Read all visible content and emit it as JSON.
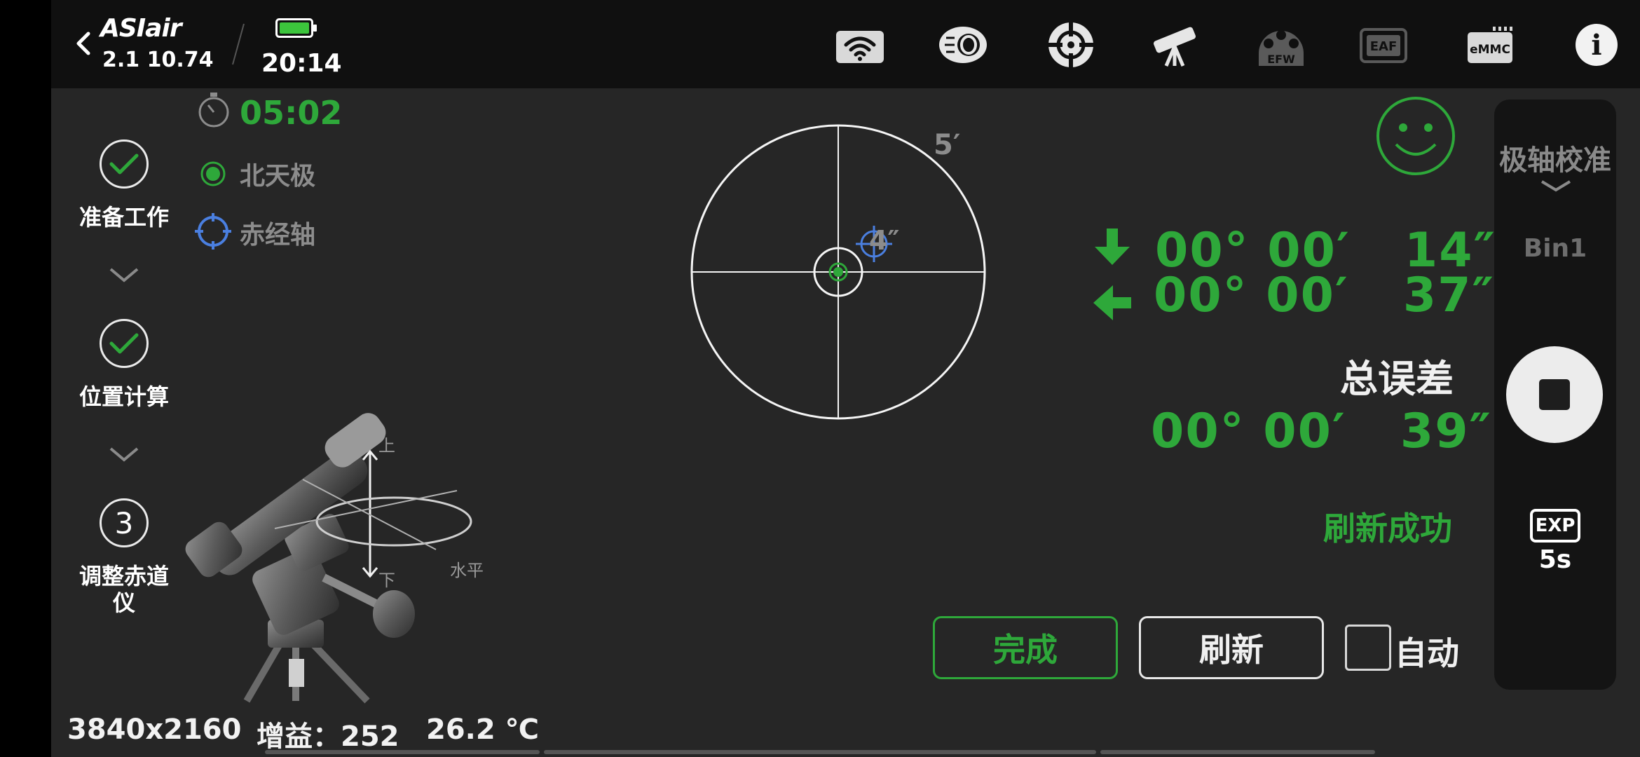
{
  "header": {
    "logo_text": "ASIair",
    "version": "2.1 10.74",
    "time": "20:14",
    "icons": [
      "wifi-icon",
      "camera-icon",
      "guide-icon",
      "telescope-icon",
      "efw-icon",
      "eaf-icon",
      "emmc-icon",
      "info-icon"
    ],
    "efw_label": "EFW",
    "eaf_label": "EAF",
    "emmc_label": "eMMC",
    "info_label": "i"
  },
  "steps": [
    {
      "label": "准备工作",
      "state": "done"
    },
    {
      "label": "位置计算",
      "state": "done"
    },
    {
      "label": "调整赤道\n仪",
      "state": "current",
      "number": "3"
    }
  ],
  "timer": "05:02",
  "legend": {
    "north_pole": "北天极",
    "ra_axis": "赤经轴"
  },
  "mount_diagram": {
    "up": "上",
    "down": "下",
    "horizontal": "水平"
  },
  "target": {
    "outer_label": "5′",
    "inner_label": "4″"
  },
  "errors": {
    "altitude": "00° 00′   14″",
    "azimuth": "00° 00′   37″",
    "total_label": "总误差",
    "total": "00° 00′   39″"
  },
  "status_text": "刷新成功",
  "buttons": {
    "done": "完成",
    "refresh": "刷新",
    "auto": "自动"
  },
  "right_panel": {
    "title": "极轴校准",
    "bin": "Bin1",
    "exp_label": "EXP",
    "exp_value": "5s"
  },
  "footer": {
    "resolution": "3840x2160",
    "gain": "增益：252",
    "temperature": "26.2 ℃"
  },
  "colors": {
    "accent_green": "#2ea83a",
    "background": "#262626",
    "topbar": "#101010",
    "ra_blue": "#4a7fe0"
  }
}
